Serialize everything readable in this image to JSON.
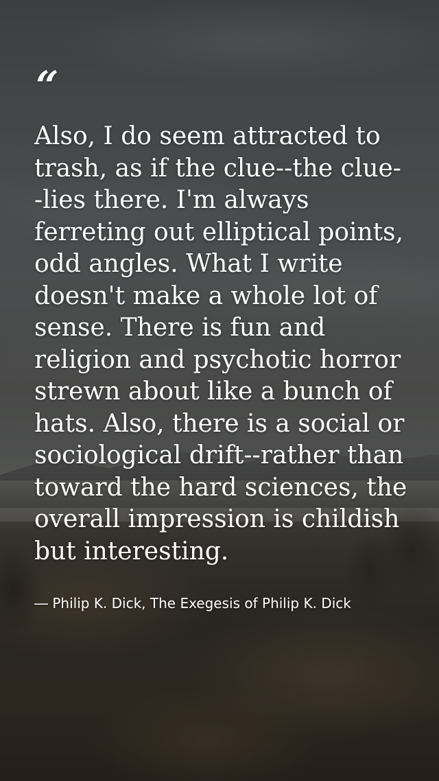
{
  "quote": {
    "open_mark": "“",
    "text": "Also, I do seem attracted to trash, as if the clue--the clue--lies there. I'm always ferreting out elliptical points, odd angles. What I write doesn't make a whole lot of sense. There is fun and religion and psychotic horror strewn about like a bunch of hats. Also, there is a social or sociological drift--rather than toward the hard sciences, the overall impression is childish but interesting.",
    "attribution": "― Philip K. Dick, The Exegesis of Philip K. Dick"
  },
  "colors": {
    "text": "#ffffff",
    "sky": "#555859",
    "land": "#3e3a33"
  }
}
